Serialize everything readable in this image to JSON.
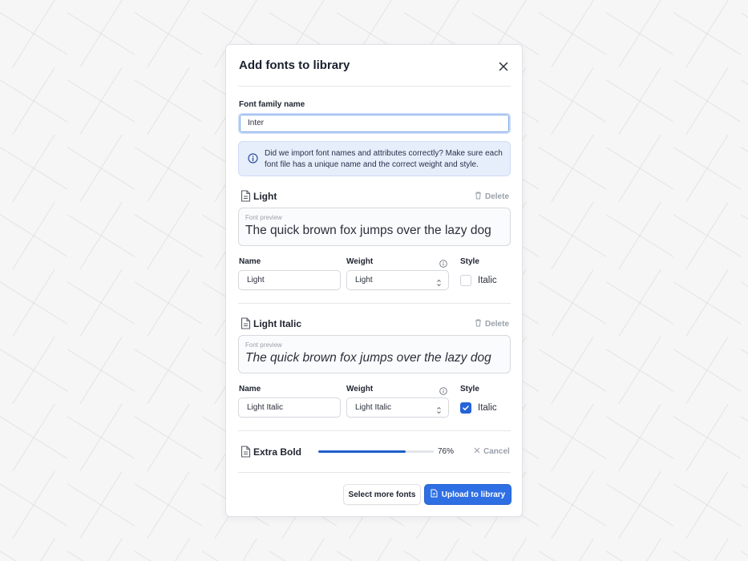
{
  "dialog": {
    "title": "Add fonts to library",
    "family_label": "Font family name",
    "family_value": "Inter",
    "alert_text": "Did we import font names and attributes correctly? Make sure each font file has a unique name and the correct weight and style."
  },
  "fonts": [
    {
      "title": "Light",
      "delete_label": "Delete",
      "preview_label": "Font preview",
      "preview_text": "The quick brown fox jumps over the lazy dog",
      "name_label": "Name",
      "name_value": "Light",
      "weight_label": "Weight",
      "weight_value": "Light",
      "style_label": "Style",
      "italic_label": "Italic",
      "italic_checked": false
    },
    {
      "title": "Light Italic",
      "delete_label": "Delete",
      "preview_label": "Font preview",
      "preview_text": "The quick brown fox jumps over the lazy dog",
      "name_label": "Name",
      "name_value": "Light Italic",
      "weight_label": "Weight",
      "weight_value": "Light Italic",
      "style_label": "Style",
      "italic_label": "Italic",
      "italic_checked": true
    }
  ],
  "uploading": {
    "title": "Extra Bold",
    "progress": 76,
    "progress_text": "76%",
    "cancel_label": "Cancel"
  },
  "footer": {
    "select_more_label": "Select more fonts",
    "upload_label": "Upload to library"
  },
  "colors": {
    "accent": "#2f6fe4",
    "alert_bg": "#e7eefb",
    "muted": "#9aa0aa"
  },
  "icons": [
    "close-icon",
    "info-icon",
    "file-icon",
    "trash-icon",
    "chevron-updown-icon",
    "check-icon",
    "x-icon",
    "upload-file-icon"
  ]
}
